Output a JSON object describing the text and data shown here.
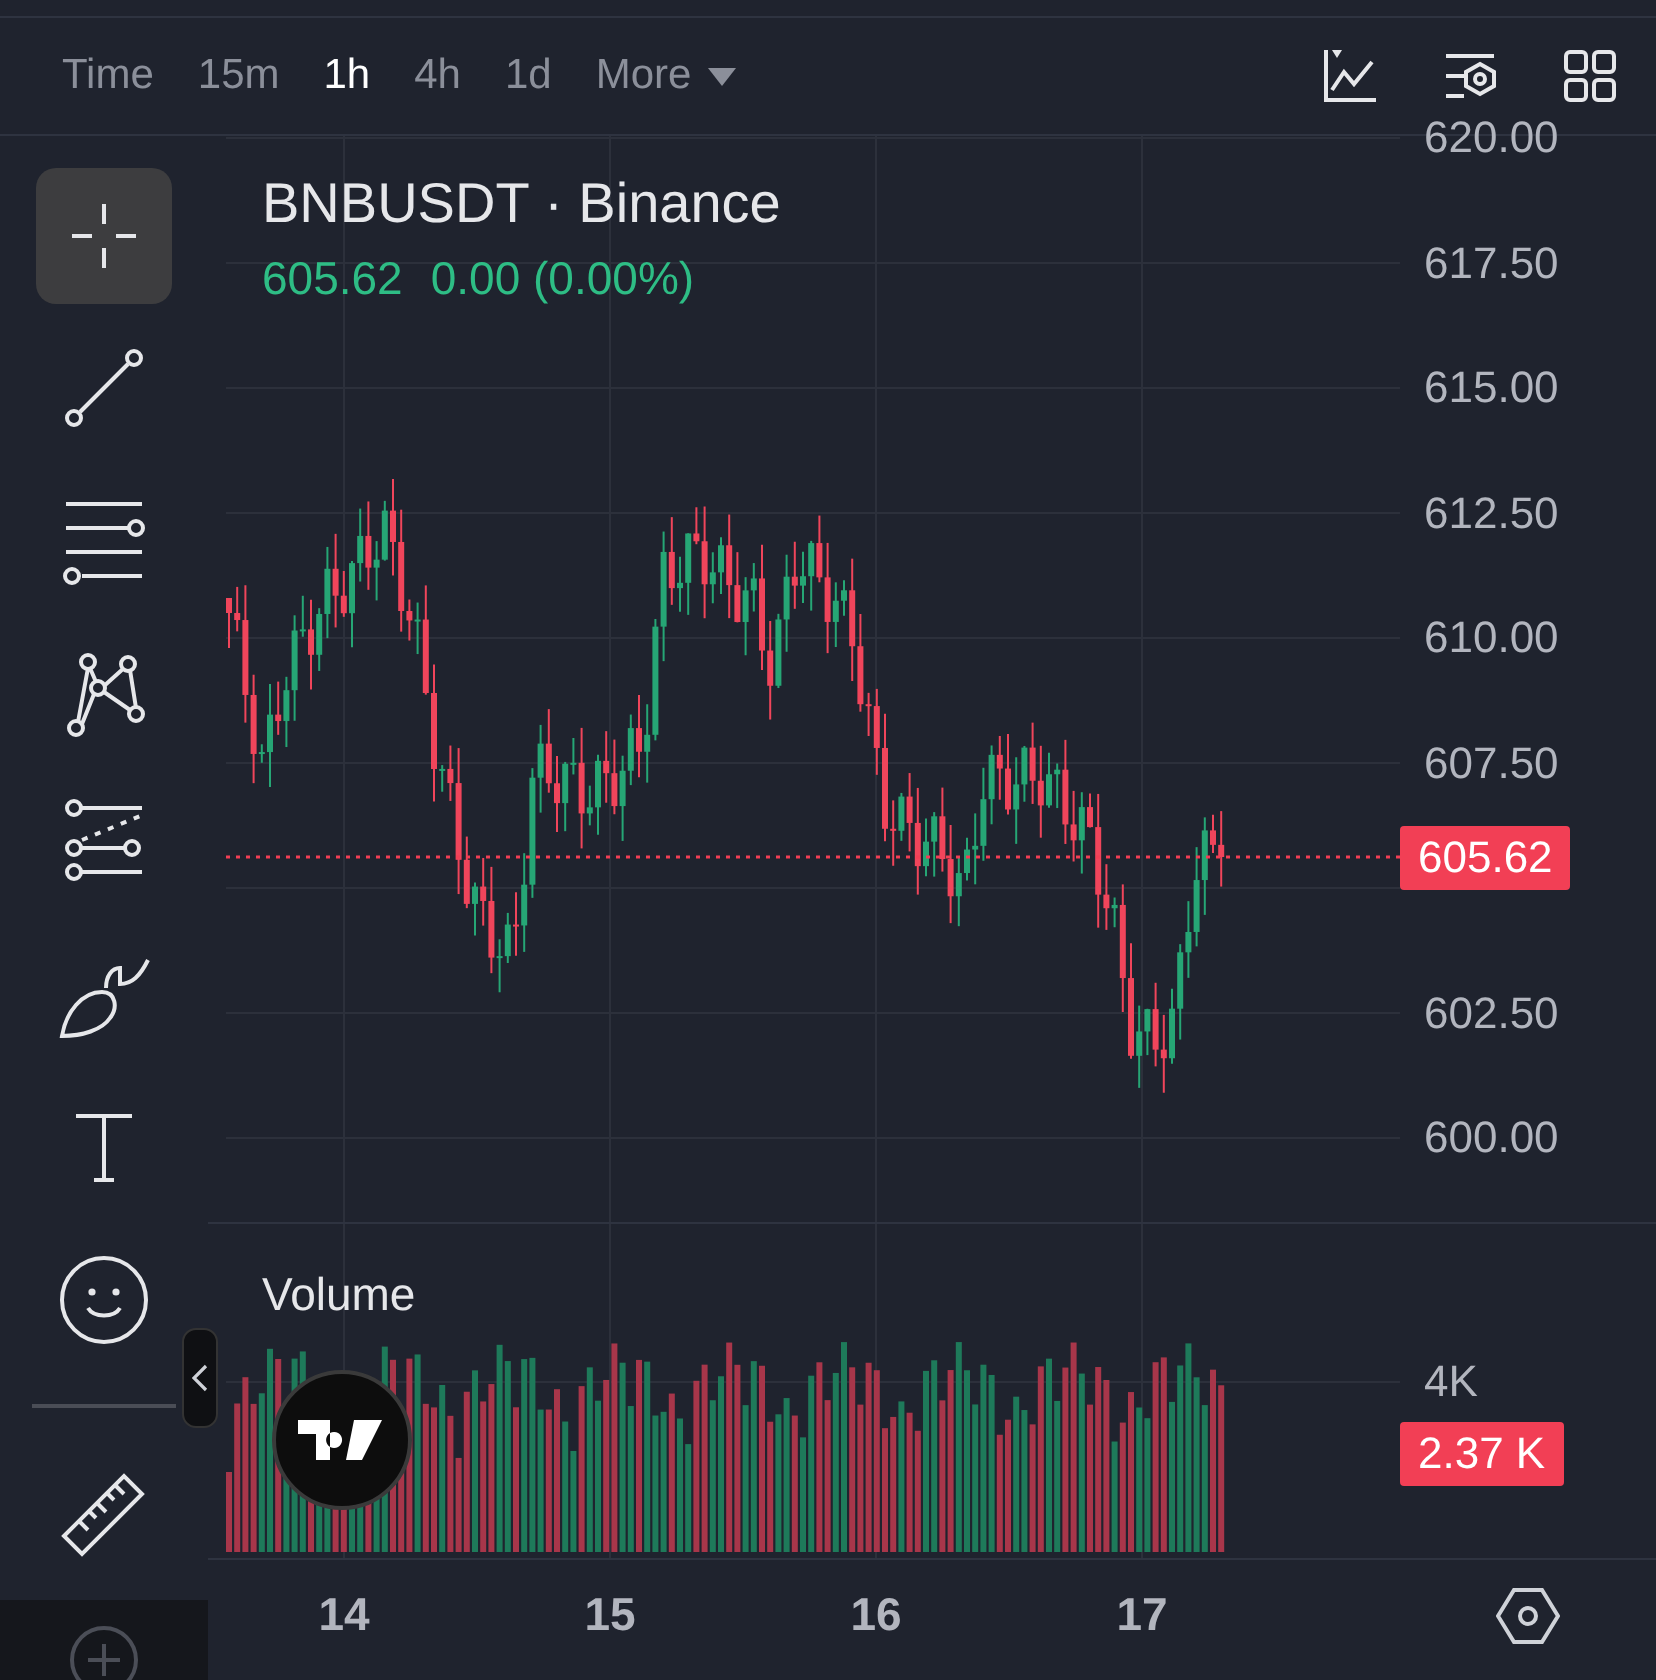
{
  "toolbar": {
    "intervals": [
      {
        "label": "Time",
        "selected": false
      },
      {
        "label": "15m",
        "selected": false
      },
      {
        "label": "1h",
        "selected": true
      },
      {
        "label": "4h",
        "selected": false
      },
      {
        "label": "1d",
        "selected": false
      }
    ],
    "more": "More"
  },
  "drawing_tools": [
    {
      "kind": "crosshair",
      "selected": true
    },
    {
      "kind": "trendline",
      "selected": false
    },
    {
      "kind": "fib",
      "selected": false
    },
    {
      "kind": "pattern",
      "selected": false
    },
    {
      "kind": "forecast",
      "selected": false
    },
    {
      "kind": "brush",
      "selected": false
    },
    {
      "kind": "text",
      "selected": false
    },
    {
      "kind": "emoji",
      "selected": false
    },
    {
      "kind": "ruler",
      "selected": false
    }
  ],
  "legend": {
    "symbol": "BNBUSDT · Binance",
    "price": "605.62",
    "change": "0.00 (0.00%)"
  },
  "price_axis": [
    "620.00",
    "617.50",
    "615.00",
    "612.50",
    "610.00",
    "607.50",
    "602.50",
    "600.00"
  ],
  "last_price": "605.62",
  "volume": {
    "title": "Volume",
    "axis": "4K",
    "last": "2.37 K"
  },
  "time_axis": [
    "14",
    "15",
    "16",
    "17"
  ]
}
